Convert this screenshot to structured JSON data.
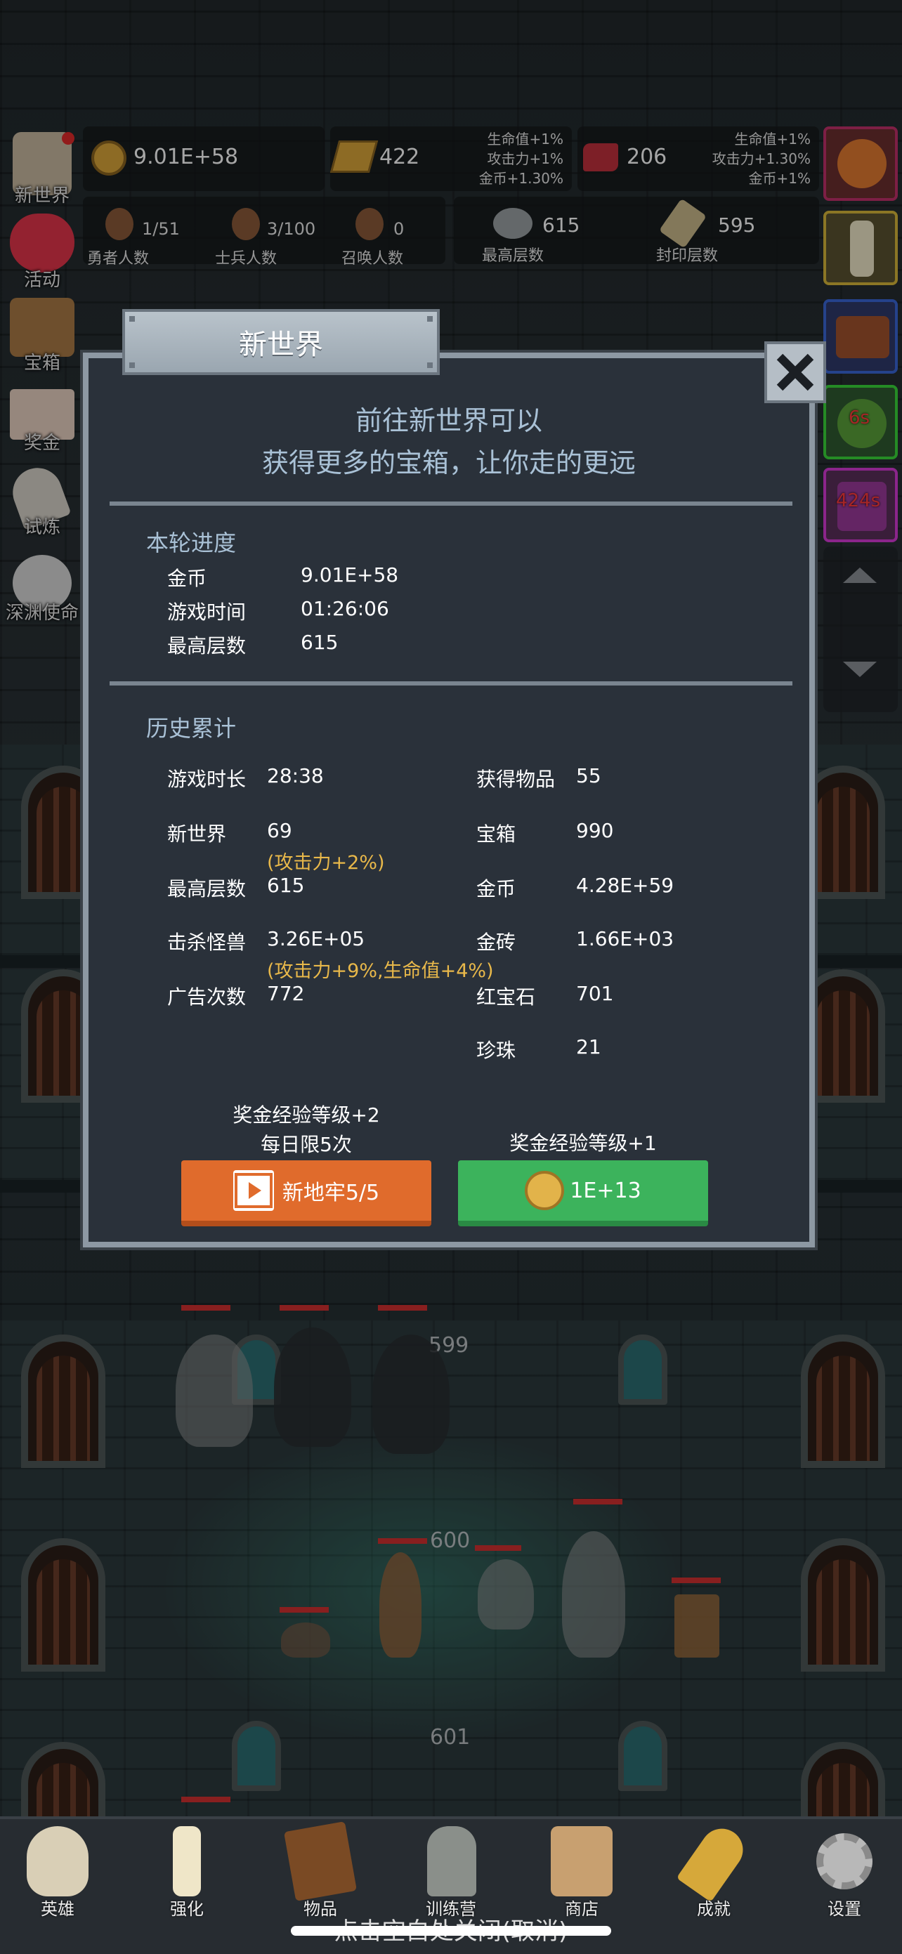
{
  "hud": {
    "gold": "9.01E+58",
    "gold_bar": "422",
    "gold_bar_bonus": [
      "生命值+1%",
      "攻击力+1%",
      "金币+1.30%"
    ],
    "ruby": "206",
    "ruby_bonus": [
      "生命值+1%",
      "攻击力+1.30%",
      "金币+1%"
    ],
    "hero_count": "1/51",
    "hero_label": "勇者人数",
    "soldier_count": "3/100",
    "soldier_label": "士兵人数",
    "summon_count": "0",
    "summon_label": "召唤人数",
    "max_floor": "615",
    "max_floor_label": "最高层数",
    "sealed_floor": "595",
    "sealed_floor_label": "封印层数"
  },
  "left_menu": [
    "新世界",
    "活动",
    "宝箱",
    "奖金",
    "试炼",
    "深渊使命"
  ],
  "right_menu": {
    "timer1": "6s",
    "timer2": "424s"
  },
  "dungeon": {
    "floors": [
      "599",
      "600",
      "601"
    ]
  },
  "dialog": {
    "title": "新世界",
    "intro_line1": "前往新世界可以",
    "intro_line2": "获得更多的宝箱，让你走的更远",
    "round_title": "本轮进度",
    "round": [
      {
        "k": "金币",
        "v": "9.01E+58"
      },
      {
        "k": "游戏时间",
        "v": "01:26:06"
      },
      {
        "k": "最高层数",
        "v": "615"
      }
    ],
    "history_title": "历史累计",
    "history_left": [
      {
        "k": "游戏时长",
        "v": "28:38"
      },
      {
        "k": "新世界",
        "v": "69"
      },
      {
        "k": "最高层数",
        "v": "615"
      },
      {
        "k": "击杀怪兽",
        "v": "3.26E+05"
      },
      {
        "k": "广告次数",
        "v": "772"
      }
    ],
    "history_right": [
      {
        "k": "获得物品",
        "v": "55"
      },
      {
        "k": "宝箱",
        "v": "990"
      },
      {
        "k": "金币",
        "v": "4.28E+59"
      },
      {
        "k": "金砖",
        "v": "1.66E+03"
      },
      {
        "k": "红宝石",
        "v": "701"
      },
      {
        "k": "珍珠",
        "v": "21"
      }
    ],
    "bonus_new_world": "(攻击力+2%)",
    "bonus_kills": "(攻击力+9%,生命值+4%)",
    "left_caption1": "奖金经验等级+2",
    "left_caption2": "每日限5次",
    "right_caption": "奖金经验等级+1",
    "left_button": "新地牢5/5",
    "right_button": "1E+13"
  },
  "bottom_nav": [
    "英雄",
    "强化",
    "物品",
    "训练营",
    "商店",
    "成就",
    "设置"
  ],
  "hint": "点击空白处关闭(取消)",
  "colors": {
    "orange_button": "#e06b2c",
    "green_button": "#3cb35c",
    "bonus_text": "#e8b84a",
    "panel": "#2a313a"
  }
}
